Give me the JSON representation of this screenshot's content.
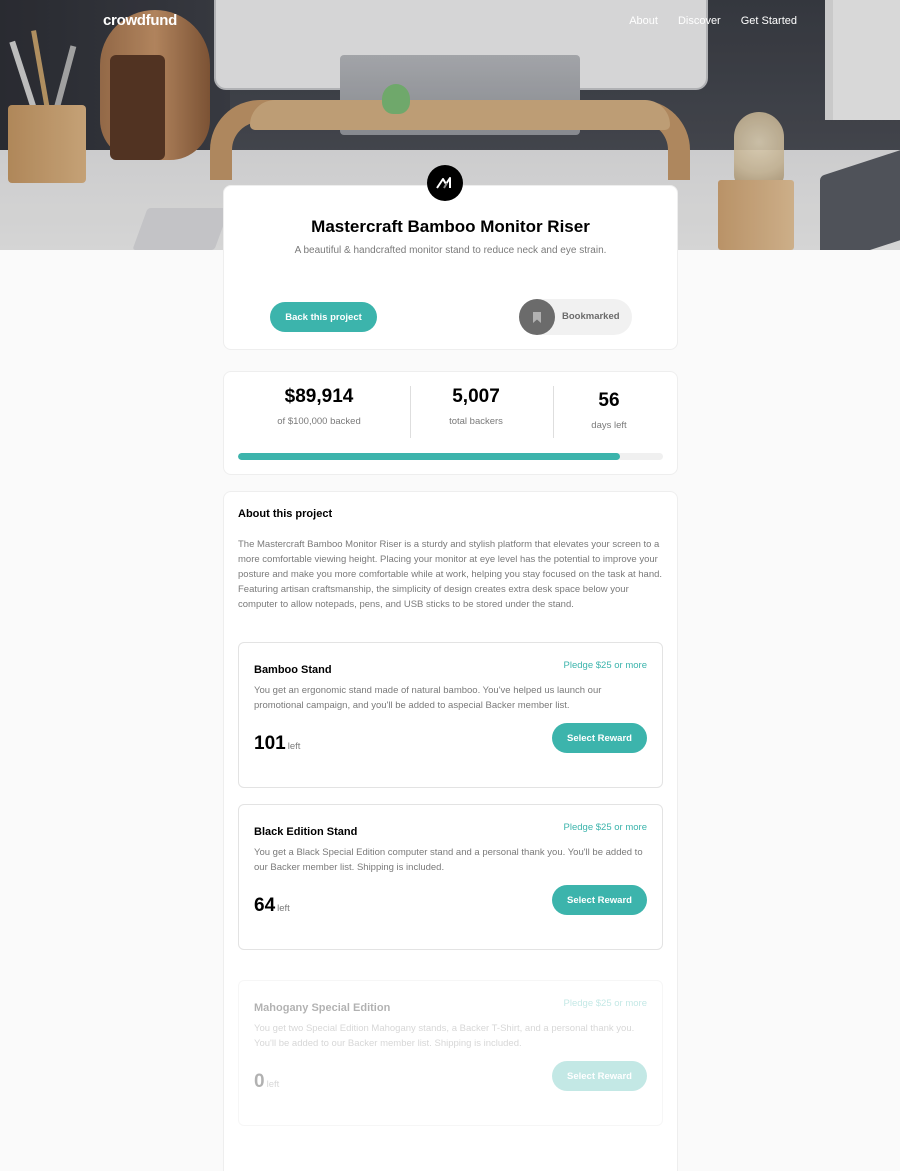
{
  "nav": {
    "logo": "crowdfund",
    "links": [
      "About",
      "Discover",
      "Get Started"
    ]
  },
  "project": {
    "title": "Mastercraft Bamboo Monitor Riser",
    "subtitle": "A beautiful & handcrafted monitor stand to reduce neck and eye strain.",
    "back_label": "Back this project",
    "bookmark_label": "Bookmarked"
  },
  "stats": {
    "backed": "$89,914",
    "backed_label": "of $100,000 backed",
    "backers": "5,007",
    "backers_label": "total backers",
    "days": "56",
    "days_label": "days left",
    "progress_fraction": 0.899
  },
  "about": {
    "heading": "About this project",
    "text": "The Mastercraft Bamboo Monitor Riser is a sturdy and stylish platform that elevates your screen to a more comfortable viewing height. Placing your monitor at eye level has the potential to improve your posture and make you more comfortable while at work, helping you stay focused on the task at hand. Featuring artisan craftsmanship, the simplicity of design creates extra desk space below your computer to allow notepads, pens, and USB sticks to be stored under the stand."
  },
  "rewards": [
    {
      "name": "Bamboo Stand",
      "pledge": "Pledge $25 or more",
      "description": "You get an ergonomic stand made of natural bamboo. You've helped us launch our promotional campaign, and you'll be added to aspecial Backer member list.",
      "left": "101",
      "left_label": "left",
      "button": "Select Reward"
    },
    {
      "name": "Black Edition Stand",
      "pledge": "Pledge $25 or more",
      "description": "You get a Black Special Edition computer stand and a personal thank you. You'll be added to our Backer member list. Shipping is included.",
      "left": "64",
      "left_label": "left",
      "button": "Select Reward"
    },
    {
      "name": "Mahogany Special Edition",
      "pledge": "Pledge $25 or more",
      "description": "You get two Special Edition Mahogany stands, a Backer T-Shirt, and a personal thank you. You'll be added to our Backer member list. Shipping is included.",
      "left": "0",
      "left_label": "left",
      "button": "Select Reward"
    }
  ],
  "colors": {
    "accent": "#3cb4ac",
    "muted_text": "#7a7a7a",
    "bookmark_grey": "#6b6b6b"
  }
}
